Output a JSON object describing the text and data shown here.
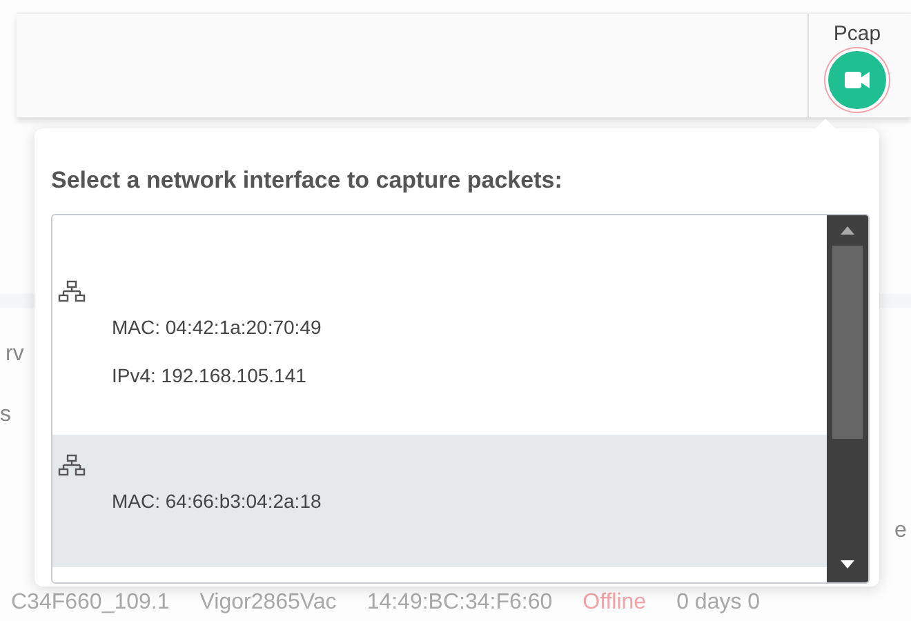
{
  "toolbar": {
    "pcap_label": "Pcap"
  },
  "background": {
    "fragments": [
      "rv",
      "s"
    ],
    "right_fragment": "e",
    "row": [
      {
        "text": "C34F660_109.1",
        "kind": "plain"
      },
      {
        "text": "Vigor2865Vac",
        "kind": "plain"
      },
      {
        "text": "14:49:BC:34:F6:60",
        "kind": "plain"
      },
      {
        "text": "Offline",
        "kind": "status"
      },
      {
        "text": "0 days 0",
        "kind": "plain"
      }
    ]
  },
  "popover": {
    "title": "Select a network interface to capture packets:",
    "interfaces": [
      {
        "selected": false,
        "lines": [
          "MAC: 04:42:1a:20:70:49",
          "IPv4: 192.168.105.141"
        ]
      },
      {
        "selected": true,
        "lines": [
          "MAC: 64:66:b3:04:2a:18"
        ]
      }
    ]
  }
}
